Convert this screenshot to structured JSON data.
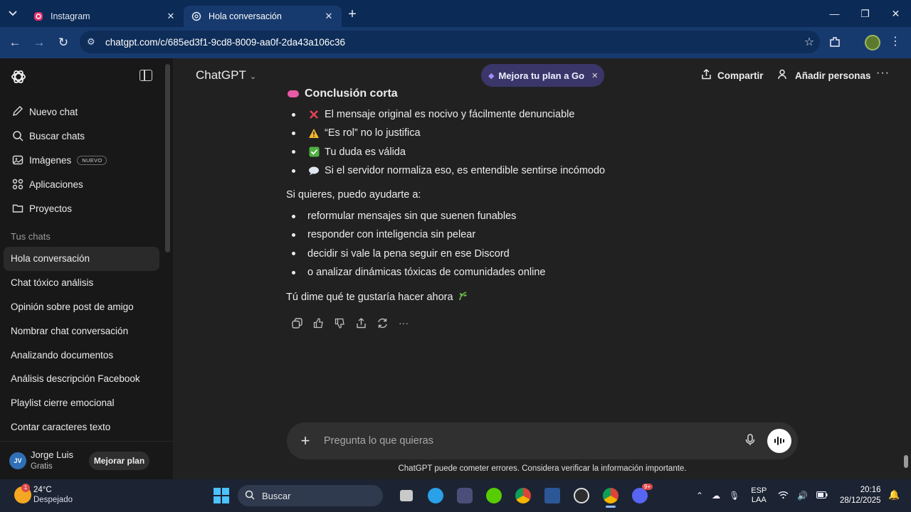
{
  "browser": {
    "tabs": [
      {
        "label": "Instagram",
        "icon": "instagram-icon"
      },
      {
        "label": "Hola conversación",
        "icon": "chatgpt-icon"
      }
    ],
    "url": "chatgpt.com/c/685ed3f1-9cd8-8009-aa0f-2da43a106c36"
  },
  "sidebar": {
    "nav": [
      {
        "label": "Nuevo chat",
        "icon": "new-chat-icon"
      },
      {
        "label": "Buscar chats",
        "icon": "search-icon"
      },
      {
        "label": "Imágenes",
        "icon": "images-icon",
        "badge": "NUEVO"
      },
      {
        "label": "Aplicaciones",
        "icon": "apps-icon"
      },
      {
        "label": "Proyectos",
        "icon": "folder-icon"
      }
    ],
    "section_title": "Tus chats",
    "chats": [
      "Hola conversación",
      "Chat tóxico análisis",
      "Opinión sobre post de amigo",
      "Nombrar chat conversación",
      "Analizando documentos",
      "Análisis descripción Facebook",
      "Playlist cierre emocional",
      "Contar caracteres texto"
    ],
    "user": {
      "initials": "JV",
      "name": "Jorge Luis",
      "plan": "Gratis",
      "upgrade_label": "Mejorar plan"
    }
  },
  "header": {
    "model": "ChatGPT",
    "promo": "Mejora tu plan a Go",
    "share": "Compartir",
    "add_people": "Añadir personas"
  },
  "message": {
    "heading": "Conclusión corta",
    "summary_bullets": [
      {
        "icon": "cross-mark-icon",
        "text": "El mensaje original es nocivo y fácilmente denunciable"
      },
      {
        "icon": "warning-icon",
        "text": "“Es rol” no lo justifica"
      },
      {
        "icon": "check-mark-icon",
        "text": "Tu duda es válida"
      },
      {
        "icon": "speech-bubble-icon",
        "text": "Si el servidor normaliza eso, es entendible sentirse incómodo"
      }
    ],
    "offer_intro": "Si quieres, puedo ayudarte a:",
    "offer_bullets": [
      "reformular mensajes sin que suenen funables",
      "responder con inteligencia sin pelear",
      "decidir si vale la pena seguir en ese Discord",
      "o analizar dinámicas tóxicas de comunidades online"
    ],
    "closing": "Tú dime qué te gustaría hacer ahora"
  },
  "composer": {
    "placeholder": "Pregunta lo que quieras",
    "disclaimer": "ChatGPT puede cometer errores. Considera verificar la información importante."
  },
  "taskbar": {
    "weather_temp": "24°C",
    "weather_desc": "Despejado",
    "weather_badge": "1",
    "search": "Buscar",
    "lang_1": "ESP",
    "lang_2": "LAA",
    "time": "20:16",
    "date": "28/12/2025",
    "discord_badge": "9+"
  },
  "colors": {
    "sidebar_bg": "#181818",
    "main_bg": "#212121",
    "browser_frame": "#0b2a55",
    "promo_bg": "#3b3669"
  }
}
